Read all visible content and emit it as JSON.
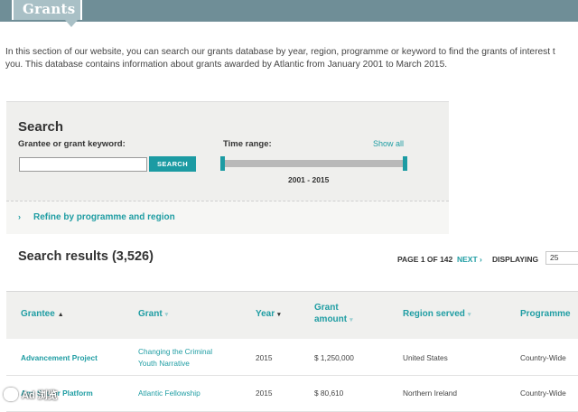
{
  "header": {
    "tab_title": "Grants"
  },
  "intro": {
    "line1": "In this section of our website, you can search our grants database by year, region, programme or keyword to find the grants of interest t",
    "line2": "you. This database contains information about grants awarded by Atlantic from January 2001 to March 2015."
  },
  "search": {
    "title": "Search",
    "keyword_label": "Grantee or grant keyword:",
    "keyword_value": "",
    "button_label": "SEARCH",
    "time_label": "Time range:",
    "show_all": "Show all",
    "range_value": "2001 - 2015"
  },
  "refine": {
    "chevron": "›",
    "label": "Refine by programme and region"
  },
  "results": {
    "title": "Search results (3,526)",
    "page_info": "PAGE 1 OF 142",
    "next_label": "NEXT ›",
    "displaying_label": "DISPLAYING",
    "per_page": "25"
  },
  "table": {
    "columns": [
      {
        "label": "Grantee",
        "sort": "▲"
      },
      {
        "label": "Grant",
        "sort": "▾"
      },
      {
        "label": "Year",
        "sort": "▾"
      },
      {
        "label_line1": "Grant",
        "label_line2": "amount",
        "sort": "▾"
      },
      {
        "label": "Region served",
        "sort": "▾"
      },
      {
        "label": "Programme",
        "sort": ""
      }
    ],
    "rows": [
      {
        "grantee": "Advancement Project",
        "grant_line1": "Changing the Criminal",
        "grant_line2": "Youth Narrative",
        "year": "2015",
        "amount": "$ 1,250,000",
        "region": "United States",
        "programme": "Country-Wide"
      },
      {
        "grantee": "Age Sector Platform",
        "grant_line1": "Atlantic Fellowship",
        "grant_line2": "",
        "year": "2015",
        "amount": "$ 80,610",
        "region": "Northern Ireland",
        "programme": "Country-Wide"
      }
    ]
  },
  "watermark": {
    "text": "Ad 浏览"
  },
  "colors": {
    "accent": "#1f9da3",
    "header_bar": "#6f8e97",
    "panel_bg": "#efefed"
  }
}
